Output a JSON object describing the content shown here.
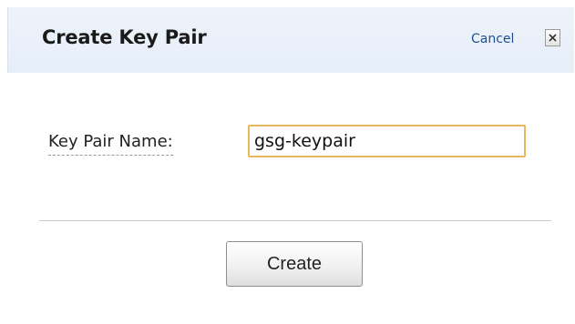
{
  "dialog": {
    "title": "Create Key Pair",
    "cancel_label": "Cancel",
    "close_icon": "close-x-icon"
  },
  "form": {
    "key_pair_name_label": "Key Pair Name:",
    "key_pair_name_value": "gsg-keypair"
  },
  "actions": {
    "create_label": "Create"
  },
  "colors": {
    "header_bg": "#e8eff9",
    "link": "#1d4f91",
    "input_focus_border": "#e7b75a"
  }
}
